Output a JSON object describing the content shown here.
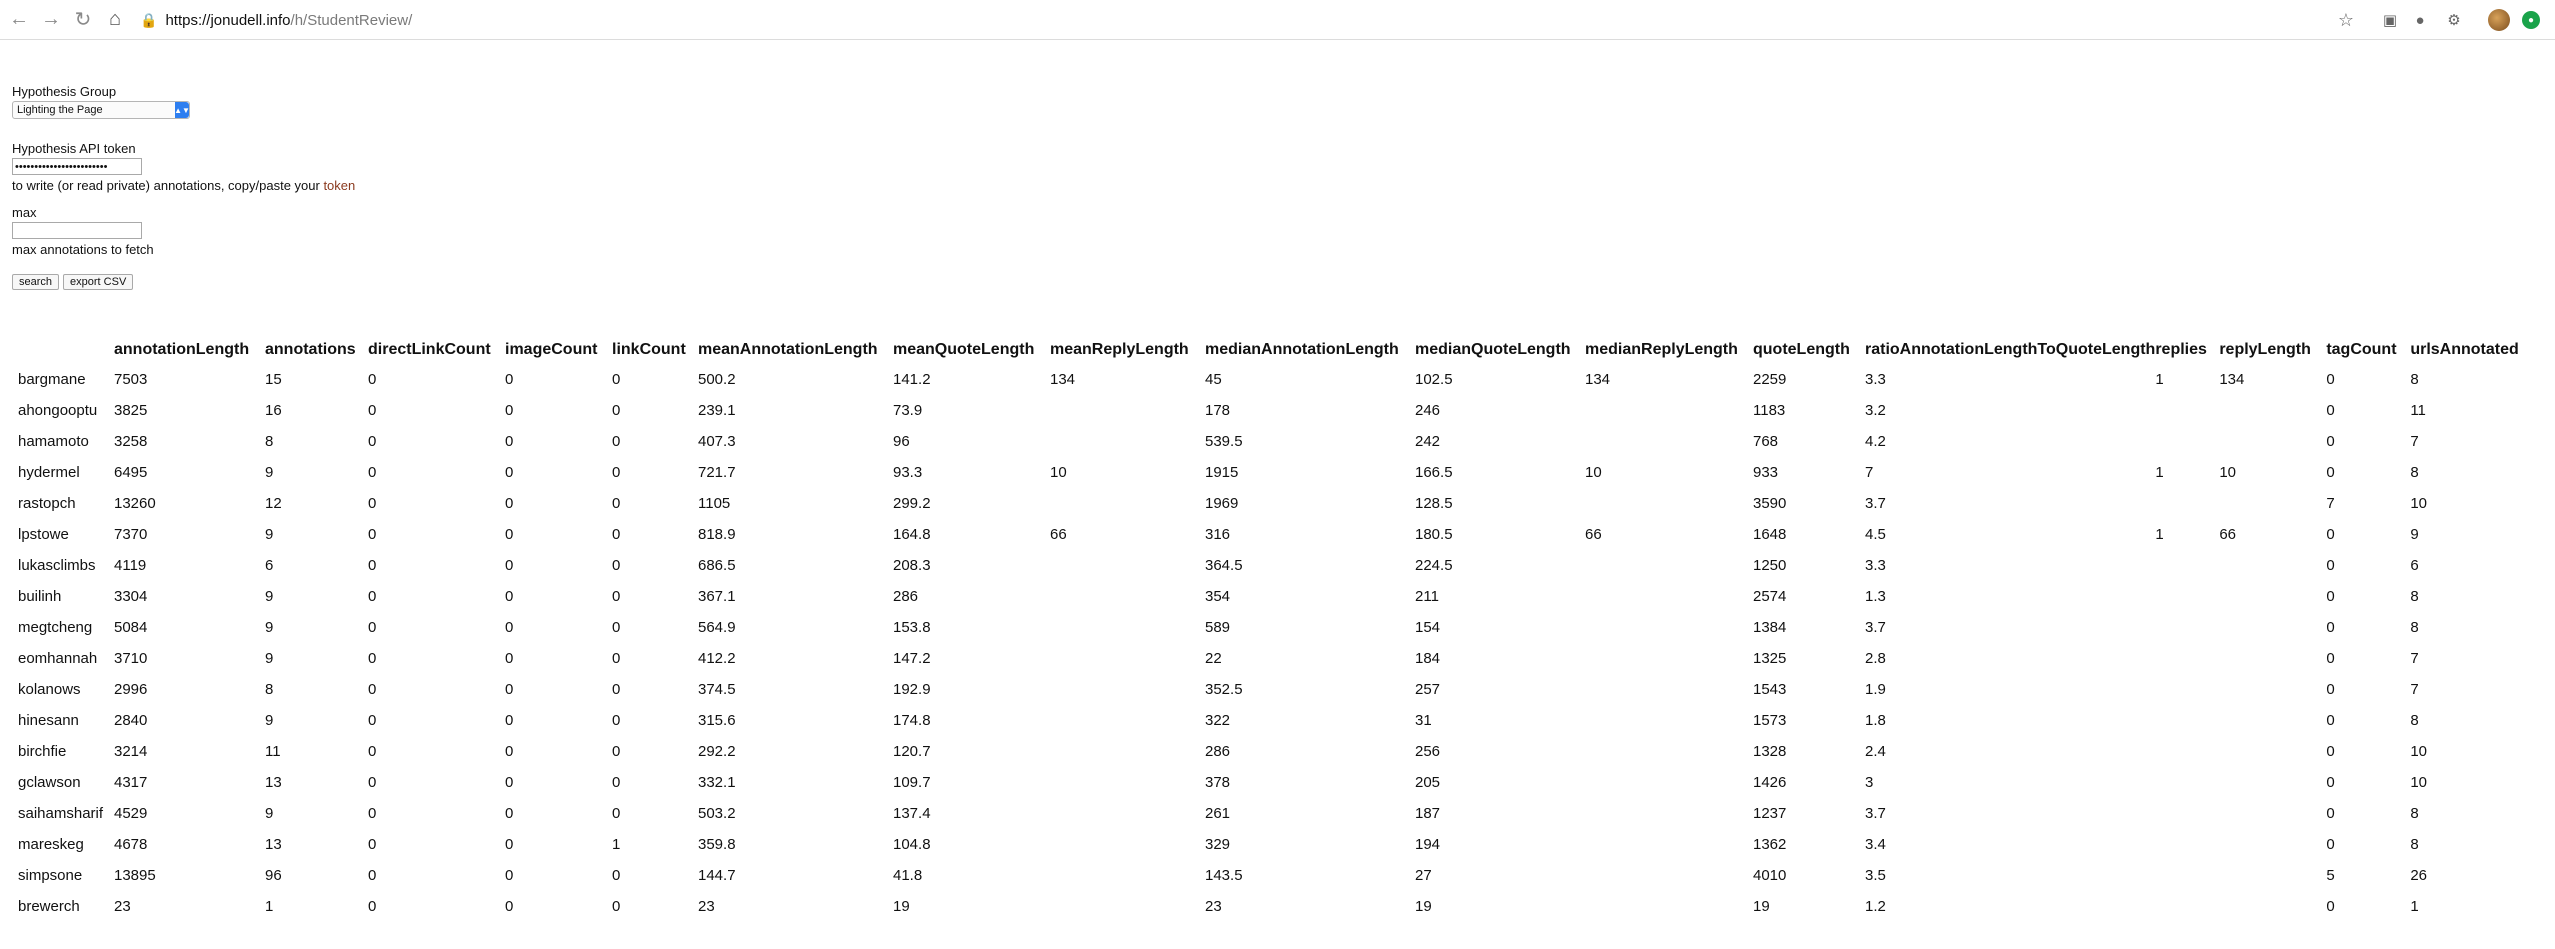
{
  "browser": {
    "url_host": "https://jonudell.info",
    "url_path": "/h/StudentReview/"
  },
  "form": {
    "group_label": "Hypothesis Group",
    "group_selected": "Lighting the Page",
    "token_label": "Hypothesis API token",
    "token_value": "••••••••••••••••••••••••",
    "token_help": "to write (or read private) annotations, copy/paste your ",
    "token_link": "token",
    "max_label": "max",
    "max_value": "",
    "max_help": "max annotations to fetch",
    "search_label": "search",
    "export_label": "export CSV"
  },
  "table": {
    "columns": [
      "",
      "annotationLength",
      "annotations",
      "directLinkCount",
      "imageCount",
      "linkCount",
      "meanAnnotationLength",
      "meanQuoteLength",
      "meanReplyLength",
      "medianAnnotationLength",
      "medianQuoteLength",
      "medianReplyLength",
      "quoteLength",
      "ratioAnnotationLengthToQuoteLength",
      "replies",
      "replyLength",
      "tagCount",
      "urlsAnnotated"
    ],
    "rows": [
      [
        "bargmane",
        "7503",
        "15",
        "0",
        "0",
        "0",
        "500.2",
        "141.2",
        "134",
        "45",
        "102.5",
        "134",
        "2259",
        "3.3",
        "1",
        "134",
        "0",
        "8"
      ],
      [
        "ahongooptu",
        "3825",
        "16",
        "0",
        "0",
        "0",
        "239.1",
        "73.9",
        "",
        "178",
        "246",
        "",
        "1183",
        "3.2",
        "",
        "",
        "0",
        "11"
      ],
      [
        "hamamoto",
        "3258",
        "8",
        "0",
        "0",
        "0",
        "407.3",
        "96",
        "",
        "539.5",
        "242",
        "",
        "768",
        "4.2",
        "",
        "",
        "0",
        "7"
      ],
      [
        "hydermel",
        "6495",
        "9",
        "0",
        "0",
        "0",
        "721.7",
        "93.3",
        "10",
        "1915",
        "166.5",
        "10",
        "933",
        "7",
        "1",
        "10",
        "0",
        "8"
      ],
      [
        "rastopch",
        "13260",
        "12",
        "0",
        "0",
        "0",
        "1105",
        "299.2",
        "",
        "1969",
        "128.5",
        "",
        "3590",
        "3.7",
        "",
        "",
        "7",
        "10"
      ],
      [
        "lpstowe",
        "7370",
        "9",
        "0",
        "0",
        "0",
        "818.9",
        "164.8",
        "66",
        "316",
        "180.5",
        "66",
        "1648",
        "4.5",
        "1",
        "66",
        "0",
        "9"
      ],
      [
        "lukasclimbs",
        "4119",
        "6",
        "0",
        "0",
        "0",
        "686.5",
        "208.3",
        "",
        "364.5",
        "224.5",
        "",
        "1250",
        "3.3",
        "",
        "",
        "0",
        "6"
      ],
      [
        "builinh",
        "3304",
        "9",
        "0",
        "0",
        "0",
        "367.1",
        "286",
        "",
        "354",
        "211",
        "",
        "2574",
        "1.3",
        "",
        "",
        "0",
        "8"
      ],
      [
        "megtcheng",
        "5084",
        "9",
        "0",
        "0",
        "0",
        "564.9",
        "153.8",
        "",
        "589",
        "154",
        "",
        "1384",
        "3.7",
        "",
        "",
        "0",
        "8"
      ],
      [
        "eomhannah",
        "3710",
        "9",
        "0",
        "0",
        "0",
        "412.2",
        "147.2",
        "",
        "22",
        "184",
        "",
        "1325",
        "2.8",
        "",
        "",
        "0",
        "7"
      ],
      [
        "kolanows",
        "2996",
        "8",
        "0",
        "0",
        "0",
        "374.5",
        "192.9",
        "",
        "352.5",
        "257",
        "",
        "1543",
        "1.9",
        "",
        "",
        "0",
        "7"
      ],
      [
        "hinesann",
        "2840",
        "9",
        "0",
        "0",
        "0",
        "315.6",
        "174.8",
        "",
        "322",
        "31",
        "",
        "1573",
        "1.8",
        "",
        "",
        "0",
        "8"
      ],
      [
        "birchfie",
        "3214",
        "11",
        "0",
        "0",
        "0",
        "292.2",
        "120.7",
        "",
        "286",
        "256",
        "",
        "1328",
        "2.4",
        "",
        "",
        "0",
        "10"
      ],
      [
        "gclawson",
        "4317",
        "13",
        "0",
        "0",
        "0",
        "332.1",
        "109.7",
        "",
        "378",
        "205",
        "",
        "1426",
        "3",
        "",
        "",
        "0",
        "10"
      ],
      [
        "saihamsharif",
        "4529",
        "9",
        "0",
        "0",
        "0",
        "503.2",
        "137.4",
        "",
        "261",
        "187",
        "",
        "1237",
        "3.7",
        "",
        "",
        "0",
        "8"
      ],
      [
        "mareskeg",
        "4678",
        "13",
        "0",
        "0",
        "1",
        "359.8",
        "104.8",
        "",
        "329",
        "194",
        "",
        "1362",
        "3.4",
        "",
        "",
        "0",
        "8"
      ],
      [
        "simpsone",
        "13895",
        "96",
        "0",
        "0",
        "0",
        "144.7",
        "41.8",
        "",
        "143.5",
        "27",
        "",
        "4010",
        "3.5",
        "",
        "",
        "5",
        "26"
      ],
      [
        "brewerch",
        "23",
        "1",
        "0",
        "0",
        "0",
        "23",
        "19",
        "",
        "23",
        "19",
        "",
        "19",
        "1.2",
        "",
        "",
        "0",
        "1"
      ]
    ]
  }
}
